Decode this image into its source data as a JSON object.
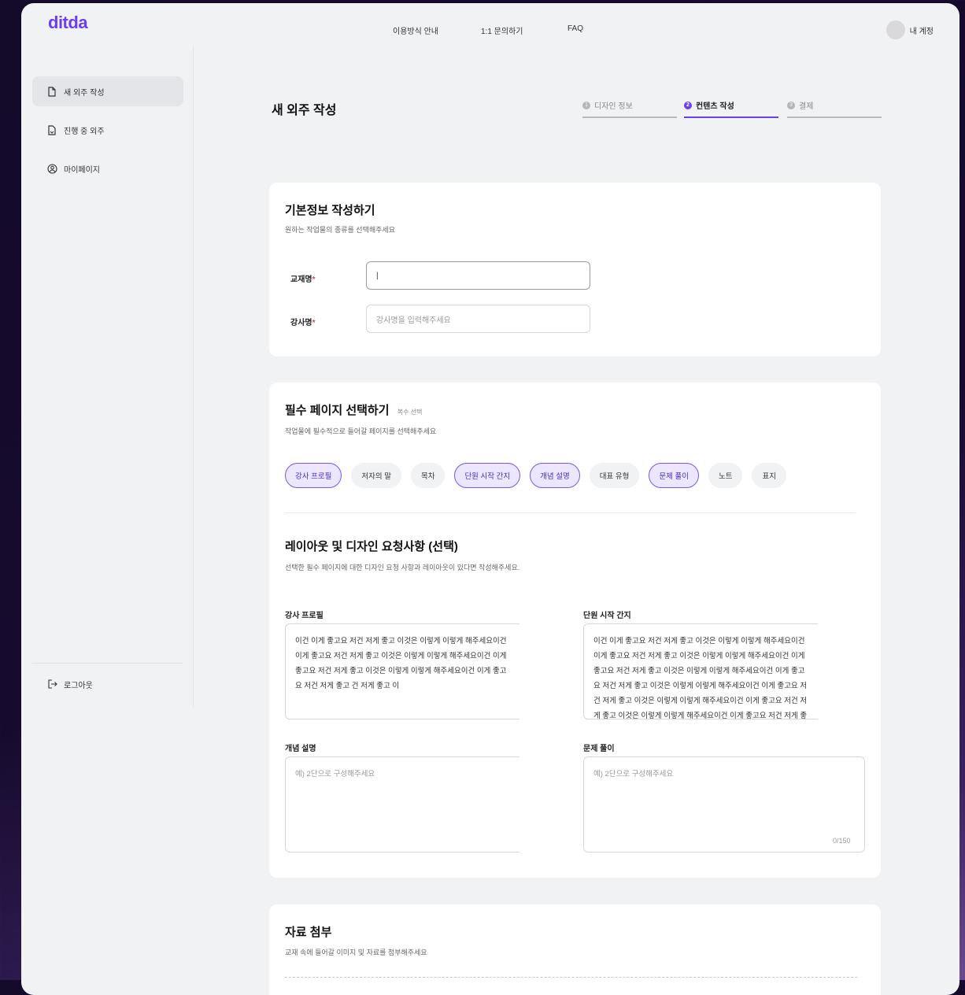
{
  "app": {
    "logo": "ditda"
  },
  "topnav": [
    "이용방식 안내",
    "1:1 문의하기",
    "FAQ"
  ],
  "account": {
    "label": "내 계정"
  },
  "sidebar": {
    "items": [
      {
        "label": "새 외주 작성",
        "icon": "document-icon",
        "active": true
      },
      {
        "label": "진행 중 외주",
        "icon": "document-progress-icon",
        "active": false
      },
      {
        "label": "마이페이지",
        "icon": "user-circle-icon",
        "active": false
      }
    ],
    "logout": "로그아웃"
  },
  "page": {
    "title": "새 외주 작성"
  },
  "steps": [
    {
      "num": "1",
      "label": "디자인 정보",
      "active": false
    },
    {
      "num": "2",
      "label": "컨텐츠 작성",
      "active": true
    },
    {
      "num": "3",
      "label": "결제",
      "active": false
    }
  ],
  "basic": {
    "title": "기본정보 작성하기",
    "subtitle": "원하는 작업물의 종류를 선택해주세요",
    "textbook_label": "교재명",
    "textbook_value": "|",
    "instructor_label": "강사명",
    "instructor_placeholder": "강사명을 입력해주세요",
    "required_mark": "*"
  },
  "pages": {
    "title": "필수 페이지 선택하기",
    "multi_note": "복수 선택",
    "subtitle": "작업물에 필수적으로 들어갈 페이지를 선택해주세요",
    "chips": [
      {
        "label": "강사 프로필",
        "selected": true
      },
      {
        "label": "저자의 말",
        "selected": false
      },
      {
        "label": "목차",
        "selected": false
      },
      {
        "label": "단원 시작 간지",
        "selected": true
      },
      {
        "label": "개념 설명",
        "selected": true
      },
      {
        "label": "대표 유형",
        "selected": false
      },
      {
        "label": "문제 풀이",
        "selected": true
      },
      {
        "label": "노트",
        "selected": false
      },
      {
        "label": "표지",
        "selected": false
      }
    ]
  },
  "layout": {
    "title": "레이아웃 및 디자인 요청사항 (선택)",
    "subtitle": "선택한 필수 페이지에 대한 디자인 요청 사항과 레이아웃이 있다면 작성해주세요.",
    "fields": {
      "profile_label": "강사 프로필",
      "profile_text": "이건 이게 좋고요 저건 저게 좋고 이것은 이렇게 이렇게 해주세요이건 이게 좋고요 저건 저게 좋고 이것은 이렇게 이렇게 해주세요이건 이게 좋고요 저건 저게 좋고 이것은 이렇게 이렇게 해주세요이건 이게 좋고요 저건 저게 좋고 건 저게 좋고 이",
      "chapter_label": "단원 시작 간지",
      "chapter_text": "이건 이게 좋고요 저건 저게 좋고 이것은 이렇게 이렇게 해주세요이건 이게 좋고요 저건 저게 좋고 이것은 이렇게 이렇게 해주세요이건 이게 좋고요 저건 저게 좋고 이것은 이렇게 이렇게 해주세요이건 이게 좋고요 저건 저게 좋고 이것은 이렇게 이렇게 해주세요이건 이게 좋고요 저건 저게 좋고 이것은 이렇게 이렇게 해주세요이건 이게 좋고요 저건 저게 좋고 이것은 이렇게 이렇게 해주세요이건 이게 좋고요 저건 저게 좋고 이것은",
      "concept_label": "개념 설명",
      "concept_placeholder": "예) 2단으로 구성해주세요",
      "problem_label": "문제 풀이",
      "problem_placeholder": "예) 2단으로 구성해주세요",
      "problem_counter": "0/150"
    }
  },
  "attach": {
    "title": "자료 첨부",
    "subtitle": "교재 속에 들어갈 이미지 및 자료를 첨부해주세요"
  },
  "colors": {
    "accent": "#6b3ff0",
    "required": "#e0465a"
  }
}
